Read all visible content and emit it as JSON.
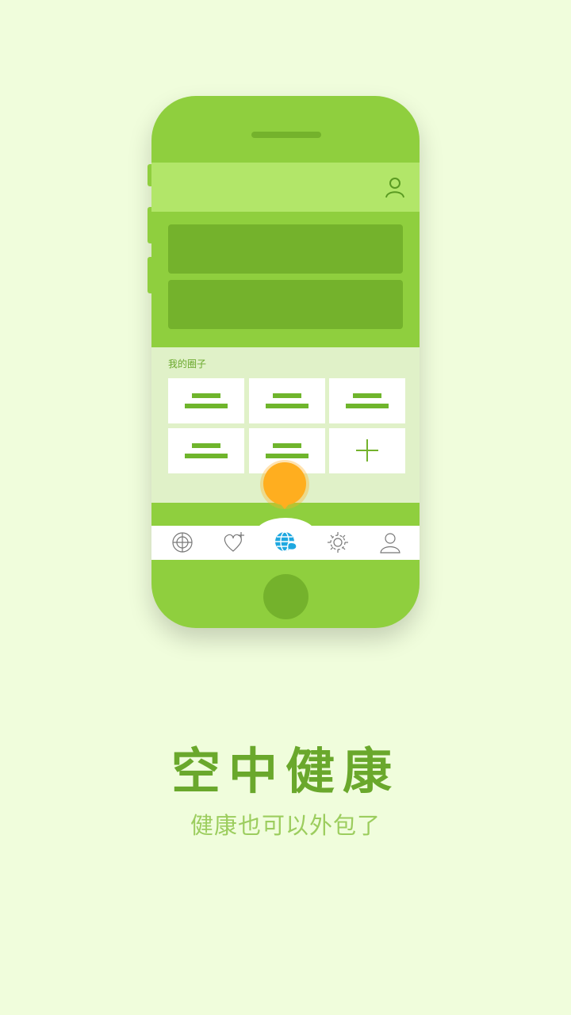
{
  "phone": {
    "section_title": "我的圈子",
    "banners": [
      "",
      ""
    ],
    "circles": [
      {
        "icon": "equal-bars-icon"
      },
      {
        "icon": "equal-bars-icon"
      },
      {
        "icon": "equal-bars-icon"
      },
      {
        "icon": "equal-bars-icon"
      },
      {
        "icon": "equal-bars-icon"
      },
      {
        "icon": "plus-icon"
      }
    ],
    "tabs": [
      {
        "icon": "radar-icon",
        "active": false
      },
      {
        "icon": "heart-plus-icon",
        "active": false
      },
      {
        "icon": "globe-chat-icon",
        "active": true
      },
      {
        "icon": "gear-icon",
        "active": false
      },
      {
        "icon": "user-icon",
        "active": false
      }
    ]
  },
  "app": {
    "title": "空中健康",
    "subtitle": "健康也可以外包了"
  },
  "colors": {
    "background": "#f0fddc",
    "phone_green": "#8fcf3e",
    "dark_green": "#74b22c",
    "light_green": "#b2e669",
    "accent_orange": "#ffae1f",
    "active_tab_blue": "#1fa8e0"
  }
}
